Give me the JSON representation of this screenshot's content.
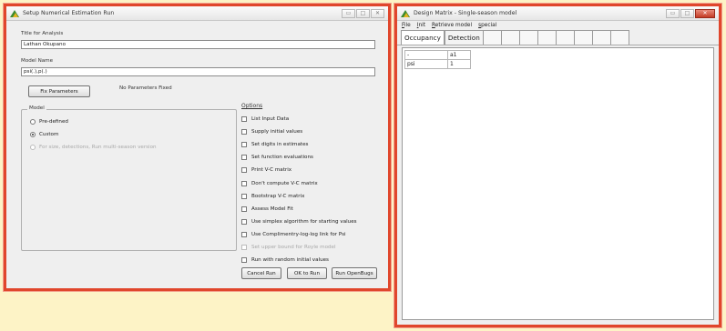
{
  "setup_window": {
    "title": "Setup Numerical Estimation Run",
    "title_label": "Title for Analysis",
    "title_value": "Lathan Okupano",
    "model_name_label": "Model Name",
    "model_name_value": "psi(.),p(.)",
    "fix_params_button": "Fix Parameters",
    "fix_params_status": "No Parameters Fixed",
    "model_group_title": "Model",
    "radios": [
      {
        "label": "Pre-defined",
        "selected": false,
        "disabled": false
      },
      {
        "label": "Custom",
        "selected": true,
        "disabled": false
      },
      {
        "label": "For size, detections, Run multi-season version",
        "selected": false,
        "disabled": true
      }
    ],
    "options_title": "Options",
    "options": [
      {
        "label": "List Input Data",
        "disabled": false
      },
      {
        "label": "Supply initial values",
        "disabled": false
      },
      {
        "label": "Set digits in estimates",
        "disabled": false
      },
      {
        "label": "Set function evaluations",
        "disabled": false
      },
      {
        "label": "Print V-C matrix",
        "disabled": false
      },
      {
        "label": "Don't compute V-C matrix",
        "disabled": false
      },
      {
        "label": "Bootstrap V-C matrix",
        "disabled": false
      },
      {
        "label": "Assess Model Fit",
        "disabled": false
      },
      {
        "label": "Use simplex algorithm for starting values",
        "disabled": false
      },
      {
        "label": "Use Complimentry-log-log link for Psi",
        "disabled": false
      },
      {
        "label": "Set upper bound for Royle model",
        "disabled": true
      },
      {
        "label": "Run with random initial values",
        "disabled": false
      }
    ],
    "buttons": {
      "cancel": "Cancel Run",
      "ok": "OK to Run",
      "openbugs": "Run OpenBugs"
    }
  },
  "design_window": {
    "title": "Design Matrix - Single-season model",
    "menu": [
      "File",
      "Init",
      "Retrieve model",
      "special"
    ],
    "tabs": [
      "Occupancy",
      "Detection"
    ],
    "grid": {
      "header": [
        "-",
        "a1"
      ],
      "rows": [
        [
          "psi",
          "1"
        ]
      ]
    }
  },
  "colors": {
    "highlight_border": "#e0462c",
    "background": "#fdf3c6"
  }
}
